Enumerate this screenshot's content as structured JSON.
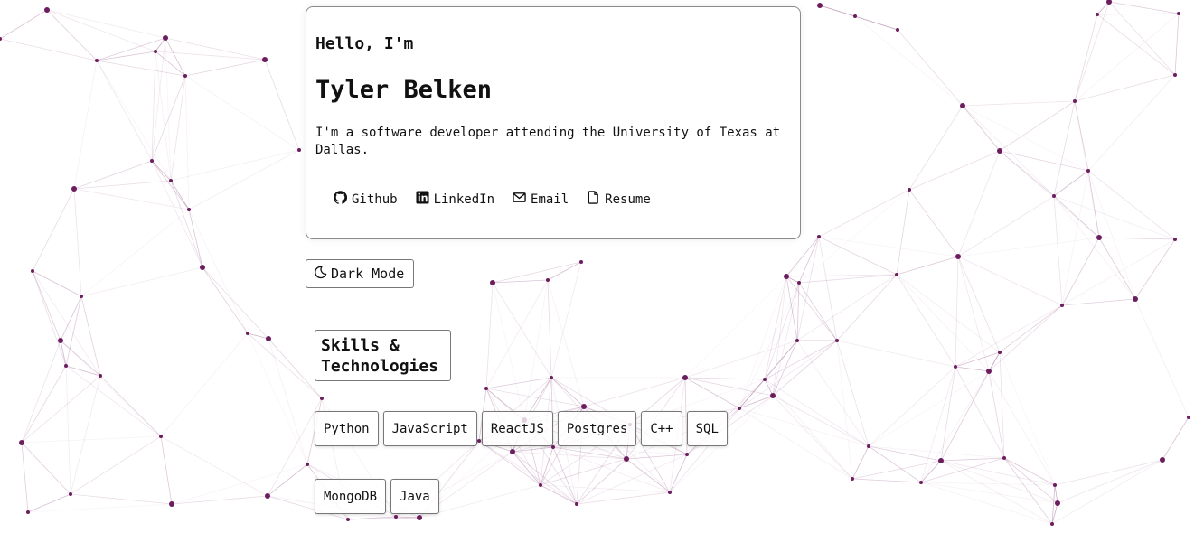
{
  "theme": {
    "accent": "#6b1d5e",
    "line": "#8e4a80"
  },
  "hero": {
    "greeting": "Hello, I'm",
    "name": "Tyler Belken",
    "bio": "I'm a software developer attending the University of Texas at Dallas."
  },
  "links": [
    {
      "label": "Github",
      "icon": "github-icon"
    },
    {
      "label": "LinkedIn",
      "icon": "linkedin-icon"
    },
    {
      "label": "Email",
      "icon": "envelope-icon"
    },
    {
      "label": "Resume",
      "icon": "document-icon"
    }
  ],
  "dark_mode": {
    "label": "Dark Mode",
    "icon": "moon-icon"
  },
  "skills": {
    "heading": "Skills & Technologies",
    "items": [
      "Python",
      "JavaScript",
      "ReactJS",
      "Postgres",
      "C++",
      "SQL",
      "MongoDB",
      "Java"
    ]
  }
}
